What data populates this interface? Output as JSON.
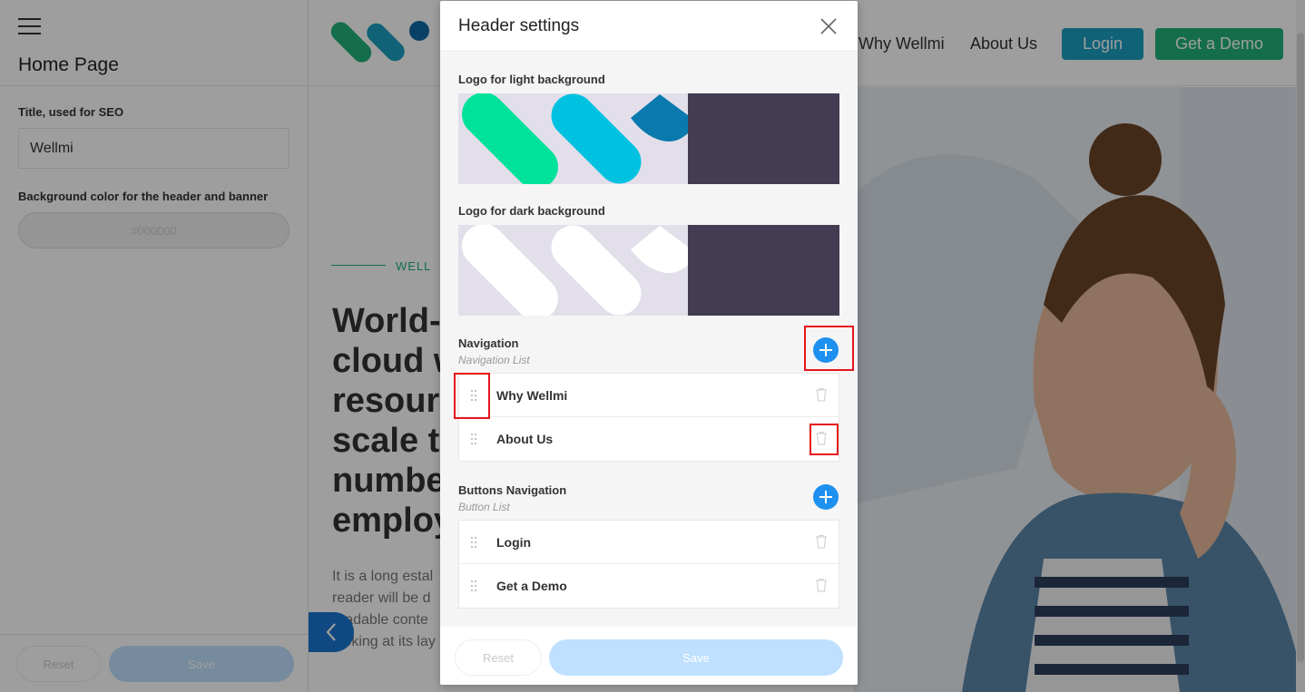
{
  "sidebar": {
    "page_title": "Home Page",
    "seo_label": "Title, used for SEO",
    "seo_value": "Wellmi",
    "bg_color_label": "Background color for the header and banner",
    "bg_color_value": "#000000",
    "reset_label": "Reset",
    "save_label": "Save"
  },
  "preview": {
    "nav": [
      "Why Wellmi",
      "About Us"
    ],
    "login_label": "Login",
    "demo_label": "Get a Demo",
    "eyebrow": "WELL",
    "headline_lines": [
      "World-",
      "cloud w",
      "resourc",
      "scale to",
      "number",
      "employ"
    ],
    "body_lines": [
      "It is a long estal",
      "reader will be d",
      "readable conte",
      "looking at its lay"
    ],
    "colors": {
      "login": "#1a9fc0",
      "demo": "#21b27a",
      "accent": "#21b27a"
    }
  },
  "modal": {
    "title": "Header settings",
    "logo_light_label": "Logo for light background",
    "logo_dark_label": "Logo for dark background",
    "navigation": {
      "title": "Navigation",
      "subtitle": "Navigation List",
      "items": [
        {
          "label": "Why Wellmi"
        },
        {
          "label": "About Us"
        }
      ]
    },
    "buttons": {
      "title": "Buttons Navigation",
      "subtitle": "Button List",
      "items": [
        {
          "label": "Login"
        },
        {
          "label": "Get a Demo"
        }
      ]
    },
    "reset_label": "Reset",
    "save_label": "Save",
    "colors": {
      "add_button": "#1e90f0",
      "highlight": "#e8141d",
      "logo_dark_bg": "#433c52",
      "logo_light_bg": "#e2dfeb"
    }
  }
}
